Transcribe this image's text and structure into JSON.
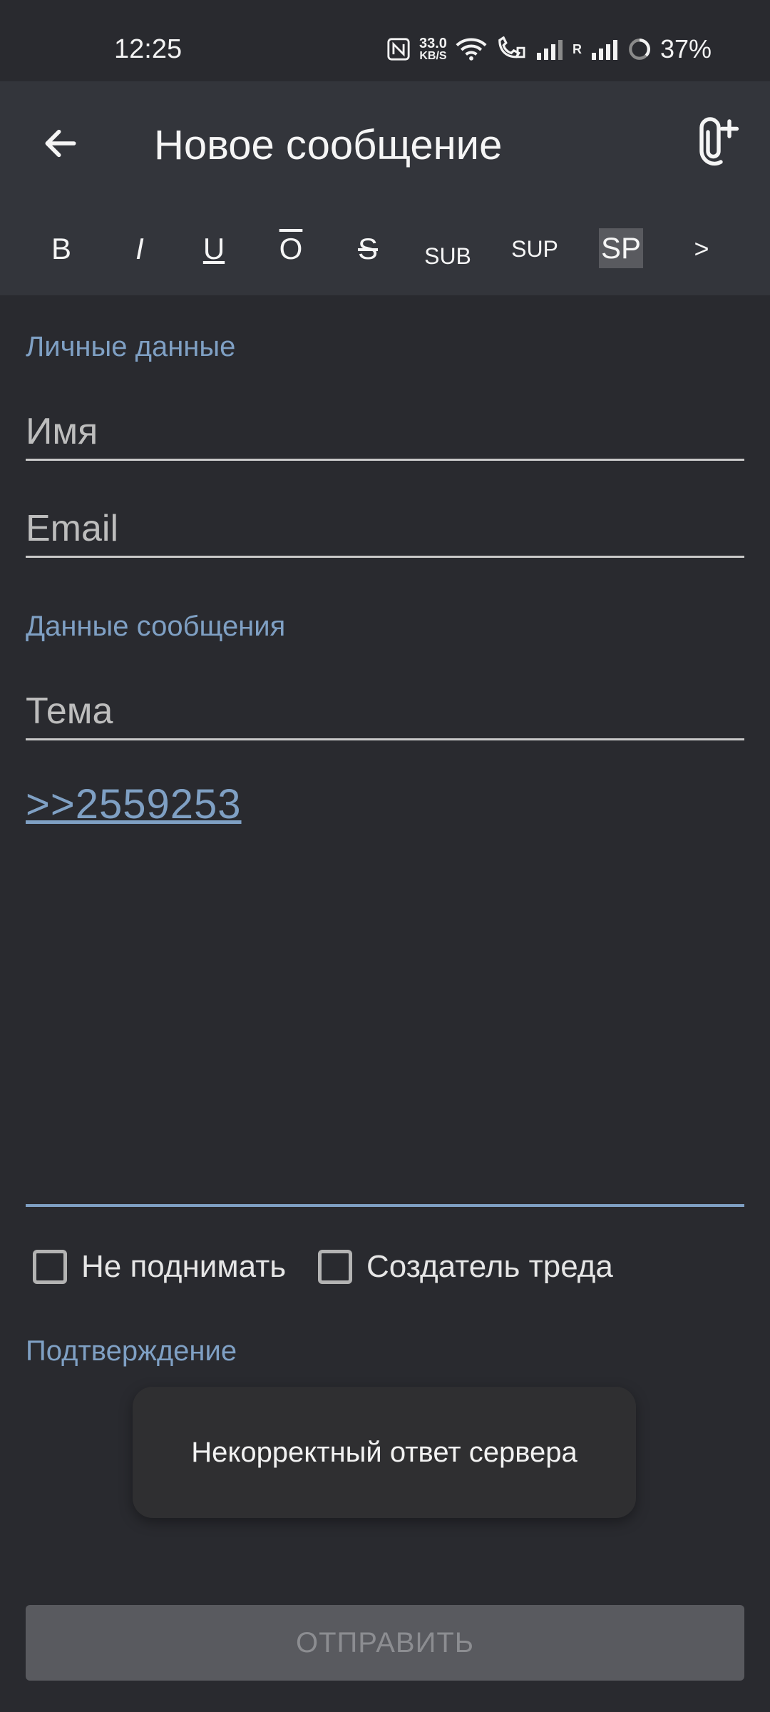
{
  "status_bar": {
    "time": "12:25",
    "speed_value": "33.0",
    "speed_unit": "KB/S",
    "roaming": "R",
    "battery": "37%"
  },
  "appbar": {
    "title": "Новое сообщение"
  },
  "toolbar": {
    "bold": "B",
    "italic": "I",
    "underline": "U",
    "overline": "O",
    "strike": "S",
    "sub": "SUB",
    "sup": "SUP",
    "spoiler": "SP",
    "quote": ">"
  },
  "form": {
    "personal_section": "Личные данные",
    "name_placeholder": "Имя",
    "email_placeholder": "Email",
    "message_section": "Данные сообщения",
    "subject_placeholder": "Тема",
    "message_text": ">>2559253",
    "no_bump_label": "Не поднимать",
    "op_label": "Создатель треда",
    "confirm_section": "Подтверждение",
    "send_label": "ОТПРАВИТЬ"
  },
  "toast": {
    "text": "Некорректный ответ сервера"
  },
  "colors": {
    "accent": "#7fa0c4",
    "background": "#292a2f",
    "appbar": "#33353b"
  }
}
